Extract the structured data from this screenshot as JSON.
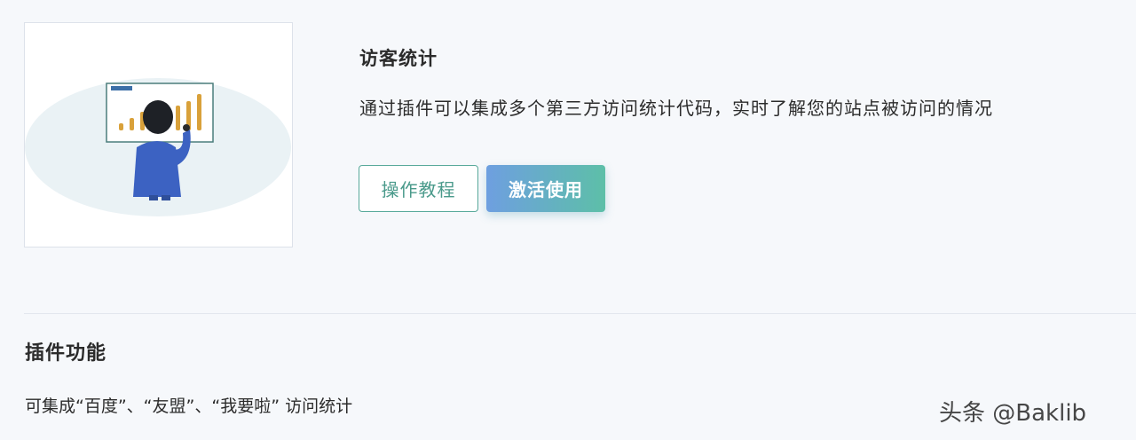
{
  "plugin": {
    "title": "访客统计",
    "description": "通过插件可以集成多个第三方访问统计代码，实时了解您的站点被访问的情况",
    "tutorial_button": "操作教程",
    "activate_button": "激活使用",
    "accent_color": "#58a99a",
    "gradient_start": "#6e9fe0",
    "gradient_end": "#5dbfa8",
    "illustration": {
      "board_label": "stats-board",
      "icon": "person-pointing-at-bar-chart"
    }
  },
  "features": {
    "title": "插件功能",
    "description": "可集成“百度”、“友盟”、“我要啦” 访问统计"
  },
  "watermark": "头条 @Baklib"
}
